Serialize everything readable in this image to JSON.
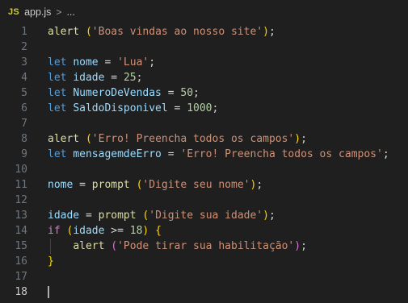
{
  "breadcrumb": {
    "file_badge": "JS",
    "file_name": "app.js",
    "separator": ">",
    "trail": "..."
  },
  "lines": [
    {
      "n": "1",
      "tokens": [
        [
          "fn",
          "alert"
        ],
        [
          "punc",
          " "
        ],
        [
          "p1",
          "("
        ],
        [
          "str",
          "'Boas vindas ao nosso site'"
        ],
        [
          "p1",
          ")"
        ],
        [
          "punc",
          ";"
        ]
      ]
    },
    {
      "n": "2",
      "tokens": []
    },
    {
      "n": "3",
      "tokens": [
        [
          "kw",
          "let"
        ],
        [
          "punc",
          " "
        ],
        [
          "var",
          "nome"
        ],
        [
          "punc",
          " = "
        ],
        [
          "str",
          "'Lua'"
        ],
        [
          "punc",
          ";"
        ]
      ]
    },
    {
      "n": "4",
      "tokens": [
        [
          "kw",
          "let"
        ],
        [
          "punc",
          " "
        ],
        [
          "var",
          "idade"
        ],
        [
          "punc",
          " = "
        ],
        [
          "num",
          "25"
        ],
        [
          "punc",
          ";"
        ]
      ]
    },
    {
      "n": "5",
      "tokens": [
        [
          "kw",
          "let"
        ],
        [
          "punc",
          " "
        ],
        [
          "var",
          "NumeroDeVendas"
        ],
        [
          "punc",
          " = "
        ],
        [
          "num",
          "50"
        ],
        [
          "punc",
          ";"
        ]
      ]
    },
    {
      "n": "6",
      "tokens": [
        [
          "kw",
          "let"
        ],
        [
          "punc",
          " "
        ],
        [
          "var",
          "SaldoDisponivel"
        ],
        [
          "punc",
          " = "
        ],
        [
          "num",
          "1000"
        ],
        [
          "punc",
          ";"
        ]
      ]
    },
    {
      "n": "7",
      "tokens": []
    },
    {
      "n": "8",
      "tokens": [
        [
          "fn",
          "alert"
        ],
        [
          "punc",
          " "
        ],
        [
          "p1",
          "("
        ],
        [
          "str",
          "'Erro! Preencha todos os campos'"
        ],
        [
          "p1",
          ")"
        ],
        [
          "punc",
          ";"
        ]
      ]
    },
    {
      "n": "9",
      "tokens": [
        [
          "kw",
          "let"
        ],
        [
          "punc",
          " "
        ],
        [
          "var",
          "mensagemdeErro"
        ],
        [
          "punc",
          " = "
        ],
        [
          "str",
          "'Erro! Preencha todos os campos'"
        ],
        [
          "punc",
          ";"
        ]
      ]
    },
    {
      "n": "10",
      "tokens": []
    },
    {
      "n": "11",
      "tokens": [
        [
          "var",
          "nome"
        ],
        [
          "punc",
          " = "
        ],
        [
          "fn",
          "prompt"
        ],
        [
          "punc",
          " "
        ],
        [
          "p1",
          "("
        ],
        [
          "str",
          "'Digite seu nome'"
        ],
        [
          "p1",
          ")"
        ],
        [
          "punc",
          ";"
        ]
      ]
    },
    {
      "n": "12",
      "tokens": []
    },
    {
      "n": "13",
      "tokens": [
        [
          "var",
          "idade"
        ],
        [
          "punc",
          " = "
        ],
        [
          "fn",
          "prompt"
        ],
        [
          "punc",
          " "
        ],
        [
          "p1",
          "("
        ],
        [
          "str",
          "'Digite sua idade'"
        ],
        [
          "p1",
          ")"
        ],
        [
          "punc",
          ";"
        ]
      ]
    },
    {
      "n": "14",
      "tokens": [
        [
          "kw2",
          "if"
        ],
        [
          "punc",
          " "
        ],
        [
          "p1",
          "("
        ],
        [
          "var",
          "idade"
        ],
        [
          "punc",
          " >= "
        ],
        [
          "num",
          "18"
        ],
        [
          "p1",
          ")"
        ],
        [
          "punc",
          " "
        ],
        [
          "p1",
          "{"
        ]
      ]
    },
    {
      "n": "15",
      "tokens": [
        [
          "punc",
          "    "
        ],
        [
          "fn",
          "alert"
        ],
        [
          "punc",
          " "
        ],
        [
          "p2",
          "("
        ],
        [
          "str",
          "'Pode tirar sua habilitação'"
        ],
        [
          "p2",
          ")"
        ],
        [
          "punc",
          ";"
        ]
      ]
    },
    {
      "n": "16",
      "tokens": [
        [
          "p1",
          "}"
        ]
      ]
    },
    {
      "n": "17",
      "tokens": []
    },
    {
      "n": "18",
      "tokens": [],
      "active": true
    }
  ]
}
